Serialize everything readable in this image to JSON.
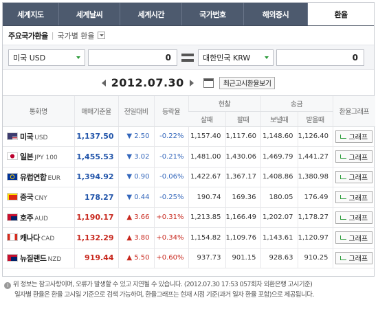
{
  "tabs": [
    {
      "label": "세계지도"
    },
    {
      "label": "세계날씨"
    },
    {
      "label": "세계시간"
    },
    {
      "label": "국가번호"
    },
    {
      "label": "해외증시"
    },
    {
      "label": "환율",
      "active": true
    }
  ],
  "subhead": {
    "title": "주요국가환율",
    "by_country": "국가별 환율"
  },
  "calculator": {
    "from_currency": "미국 USD",
    "from_amount": "0",
    "to_currency": "대한민국 KRW",
    "to_amount": "0"
  },
  "date_bar": {
    "date": "2012.07.30",
    "recent_button": "최근고시환율보기"
  },
  "table": {
    "headers": {
      "currency": "통화명",
      "base_rate": "매매기준율",
      "change": "전일대비",
      "change_pct": "등락율",
      "cash": "현찰",
      "cash_buy": "살때",
      "cash_sell": "팔때",
      "remit": "송금",
      "remit_send": "보낼때",
      "remit_recv": "받을때",
      "graph": "환율그래프"
    },
    "graph_label": "그래프",
    "rows": [
      {
        "name": "미국",
        "code": "USD",
        "flag": "us",
        "rate": "1,137.50",
        "dir": "down",
        "change": "▼ 2.50",
        "pct": "-0.22%",
        "buy": "1,157.40",
        "sell": "1,117.60",
        "send": "1,148.60",
        "recv": "1,126.40"
      },
      {
        "name": "일본",
        "code": "JPY 100",
        "flag": "jp",
        "rate": "1,455.53",
        "dir": "down",
        "change": "▼ 3.02",
        "pct": "-0.21%",
        "buy": "1,481.00",
        "sell": "1,430.06",
        "send": "1,469.79",
        "recv": "1,441.27"
      },
      {
        "name": "유럽연합",
        "code": "EUR",
        "flag": "eu",
        "rate": "1,394.92",
        "dir": "down",
        "change": "▼ 0.90",
        "pct": "-0.06%",
        "buy": "1,422.67",
        "sell": "1,367.17",
        "send": "1,408.86",
        "recv": "1,380.98"
      },
      {
        "name": "중국",
        "code": "CNY",
        "flag": "cn",
        "rate": "178.27",
        "dir": "down",
        "change": "▼ 0.44",
        "pct": "-0.25%",
        "buy": "190.74",
        "sell": "169.36",
        "send": "180.05",
        "recv": "176.49"
      },
      {
        "name": "호주",
        "code": "AUD",
        "flag": "au",
        "rate": "1,190.17",
        "dir": "up",
        "change": "▲ 3.66",
        "pct": "+0.31%",
        "buy": "1,213.85",
        "sell": "1,166.49",
        "send": "1,202.07",
        "recv": "1,178.27"
      },
      {
        "name": "캐나다",
        "code": "CAD",
        "flag": "ca",
        "rate": "1,132.29",
        "dir": "up",
        "change": "▲ 3.80",
        "pct": "+0.34%",
        "buy": "1,154.82",
        "sell": "1,109.76",
        "send": "1,143.61",
        "recv": "1,120.97"
      },
      {
        "name": "뉴질랜드",
        "code": "NZD",
        "flag": "nz",
        "rate": "919.44",
        "dir": "up",
        "change": "▲ 5.50",
        "pct": "+0.60%",
        "buy": "937.73",
        "sell": "901.15",
        "send": "928.63",
        "recv": "910.25"
      }
    ]
  },
  "notes": {
    "line1": "위 정보는 참고사항이며, 오류가 발생할 수 있고 지연될 수 있습니다. (2012.07.30 17:53 057회차 외환은행 고시기준)",
    "line2": "일자별 환율은 환율 고시일 기준으로 검색 가능하며, 환율그래프는 현재 시점 기준(과거 일자 환율 포함)으로 제공됩니다."
  },
  "colors": {
    "tab_bg": "#4d5a6e",
    "up": "#c8281e",
    "down": "#3366bb",
    "rate_blue": "#2255aa"
  }
}
